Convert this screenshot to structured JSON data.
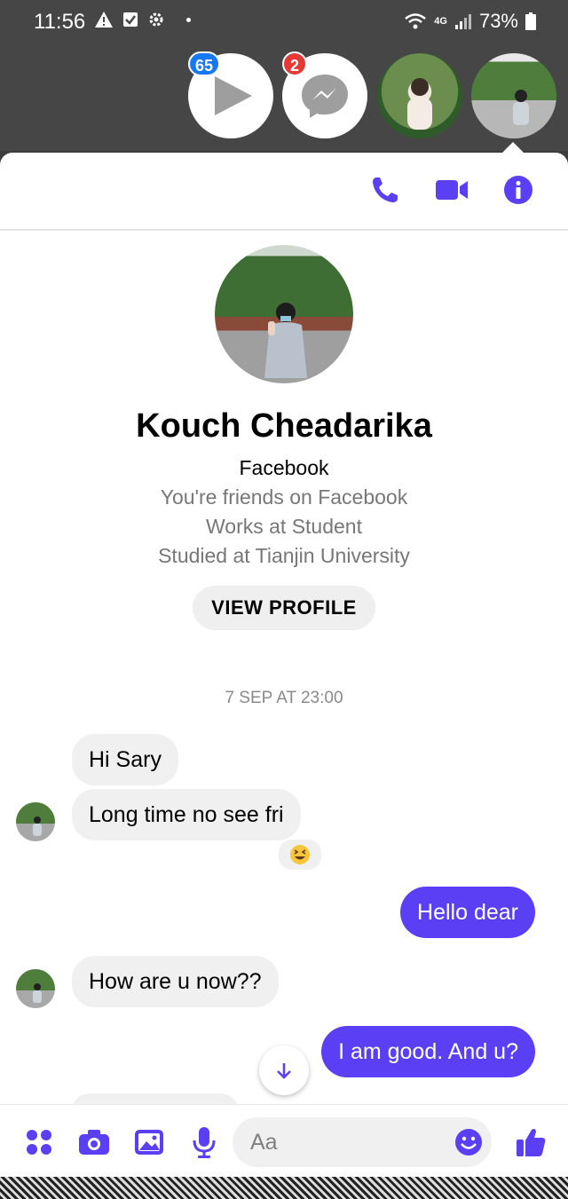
{
  "status_bar": {
    "time": "11:56",
    "network": "4G",
    "battery": "73%"
  },
  "chat_heads": {
    "video_app_badge": "65",
    "messenger_badge": "2"
  },
  "contact": {
    "name": "Kouch Cheadarika",
    "source": "Facebook",
    "friend_status": "You're friends on Facebook",
    "work": "Works at Student",
    "education": "Studied at Tianjin University",
    "view_profile_label": "VIEW PROFILE"
  },
  "conversation": {
    "timestamp": "7 SEP AT 23:00",
    "messages": [
      {
        "from": "them",
        "text": "Hi Sary"
      },
      {
        "from": "them",
        "text": "Long time no see fri"
      },
      {
        "from": "me",
        "text": "Hello dear"
      },
      {
        "from": "them",
        "text": "How are u now??"
      },
      {
        "from": "me",
        "text": "I am good. And u?"
      }
    ],
    "reaction": "grinning-squinting-face"
  },
  "composer": {
    "placeholder": "Aa"
  },
  "colors": {
    "accent": "#5b3ff5",
    "badge_blue": "#1877f2",
    "badge_red": "#e53935"
  }
}
